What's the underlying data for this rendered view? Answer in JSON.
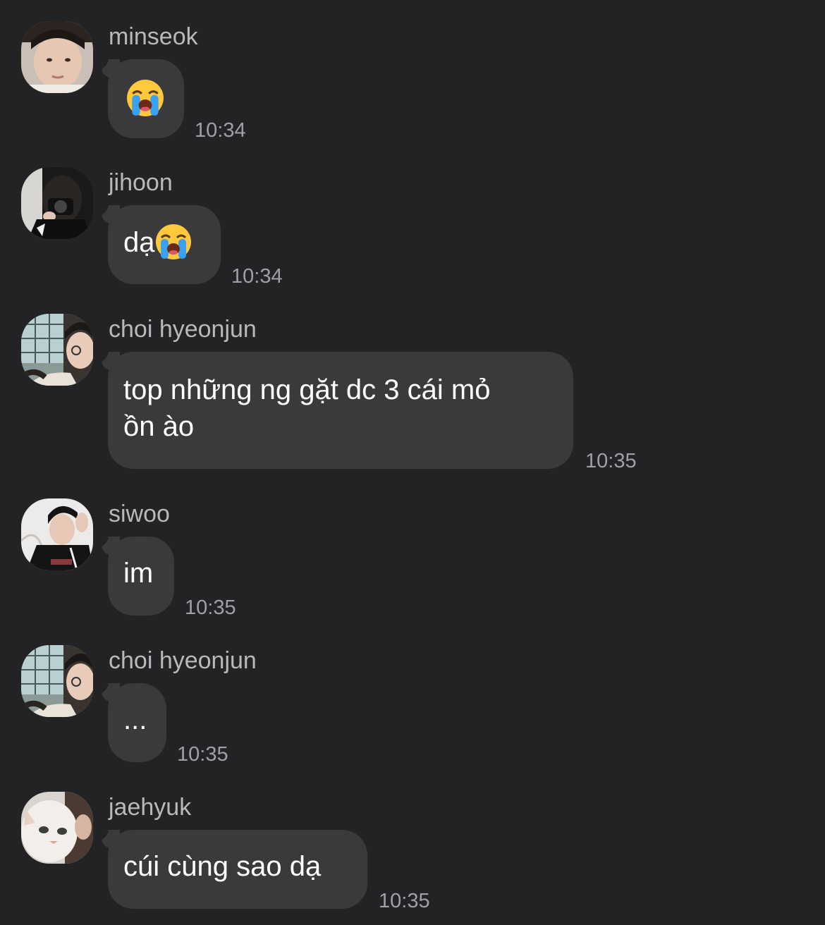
{
  "chat": {
    "messages": [
      {
        "sender": "minseok",
        "text": "",
        "emoji": "loudly-crying-face-emoji",
        "time": "10:34"
      },
      {
        "sender": "jihoon",
        "text": "dạ",
        "emoji": "loudly-crying-face-emoji",
        "time": "10:34"
      },
      {
        "sender": "choi hyeonjun",
        "line1": "top những ng gặt dc 3 cái mỏ",
        "line2": "ồn ào",
        "time": "10:35"
      },
      {
        "sender": "siwoo",
        "text": "im",
        "time": "10:35"
      },
      {
        "sender": "choi hyeonjun",
        "text": "...",
        "time": "10:35"
      },
      {
        "sender": "jaehyuk",
        "text": "cúi cùng sao dạ",
        "time": "10:35"
      }
    ]
  },
  "colors": {
    "background": "#232325",
    "bubble": "#3a3a3c",
    "sender_text": "#b9b9bc",
    "time_text": "#a0a0a4"
  }
}
